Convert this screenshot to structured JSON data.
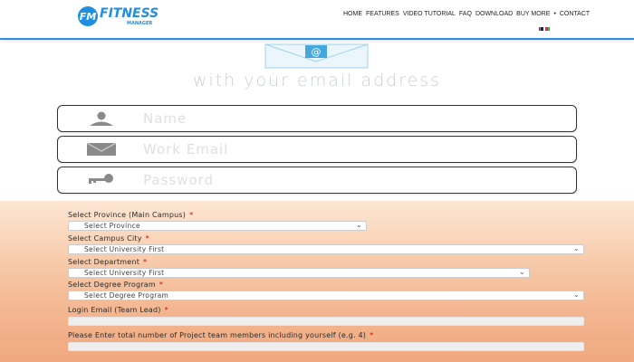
{
  "header": {
    "logo_initials": "FM",
    "logo_name": "FITNESS",
    "logo_sub": "MANAGER",
    "nav": [
      "HOME",
      "FEATURES",
      "VIDEO TUTORIAL",
      "FAQ",
      "DOWNLOAD",
      "BUY MORE",
      "CONTACT"
    ],
    "nav_separator": "•"
  },
  "signup": {
    "heading": "with your email address",
    "name_placeholder": "Name",
    "email_placeholder": "Work Email",
    "password_placeholder": "Password"
  },
  "form": {
    "province_label": "Select Province (Main Campus)",
    "province_value": "Select Province",
    "city_label": "Select Campus City",
    "city_value": "Select University First",
    "department_label": "Select Department",
    "department_value": "Select University First",
    "program_label": "Select Degree Program",
    "program_value": "Select Degree Program",
    "login_email_label": "Login Email (Team Lead)",
    "members_label": "Please Enter total number of Project team members including yourself (e.g. 4)",
    "required_mark": "*"
  },
  "colors": {
    "brand": "#1e8fe1",
    "required": "#e00000",
    "form_bg_top": "#fde7d4",
    "form_bg_bottom": "#f0a97e"
  },
  "icons": [
    "person-icon",
    "envelope-icon",
    "key-icon",
    "email-at-icon",
    "chevron-down-icon"
  ]
}
